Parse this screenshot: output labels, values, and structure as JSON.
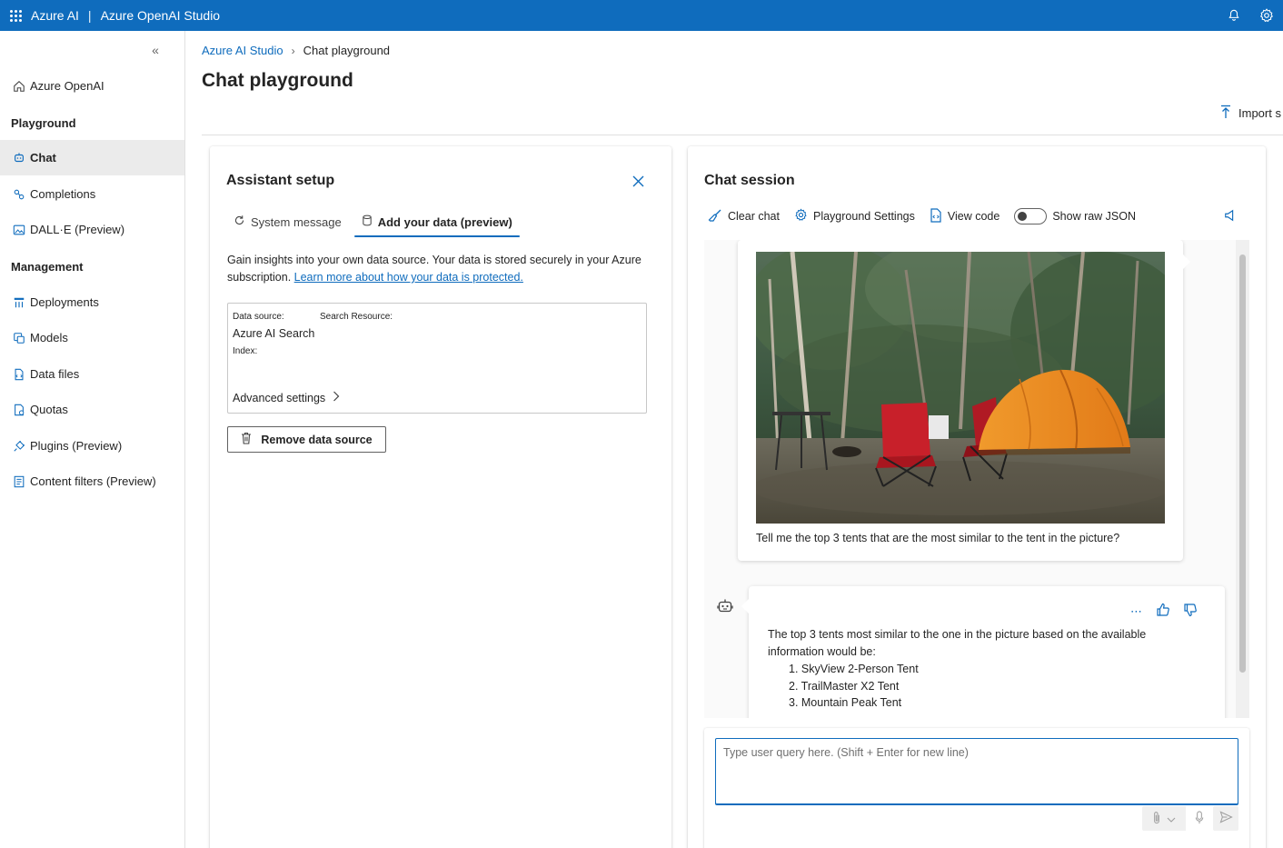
{
  "app": {
    "brand": "Azure AI",
    "separator": "|",
    "product": "Azure OpenAI Studio"
  },
  "topbar_icons": [
    "app-launcher-icon",
    "bell-icon",
    "gear-icon"
  ],
  "sidebar": {
    "home": "Azure OpenAI",
    "playground_heading": "Playground",
    "playground_items": [
      {
        "label": "Chat",
        "icon": "chat-icon",
        "active": true
      },
      {
        "label": "Completions",
        "icon": "completions-icon"
      },
      {
        "label": "DALL·E (Preview)",
        "icon": "image-icon"
      }
    ],
    "management_heading": "Management",
    "management_items": [
      {
        "label": "Deployments",
        "icon": "deployments-icon"
      },
      {
        "label": "Models",
        "icon": "models-icon"
      },
      {
        "label": "Data files",
        "icon": "data-files-icon"
      },
      {
        "label": "Quotas",
        "icon": "quotas-icon"
      },
      {
        "label": "Plugins (Preview)",
        "icon": "plugin-icon"
      },
      {
        "label": "Content filters (Preview)",
        "icon": "content-filter-icon"
      }
    ]
  },
  "breadcrumb": {
    "root": "Azure AI Studio",
    "current": "Chat playground"
  },
  "page": {
    "title": "Chat playground",
    "import_label": "Import s"
  },
  "setup": {
    "title": "Assistant setup",
    "tabs": {
      "system": "System message",
      "data": "Add your data (preview)"
    },
    "intro": "Gain insights into your own data source. Your data is stored securely in your Azure subscription. ",
    "intro_link": "Learn more about how your data is protected.",
    "data_source_label": "Data source:",
    "data_source_value": "Azure AI Search",
    "search_resource_label": "Search Resource:",
    "index_label": "Index:",
    "advanced_label": "Advanced settings",
    "remove_label": "Remove data source"
  },
  "chat": {
    "title": "Chat session",
    "toolbar": {
      "clear": "Clear chat",
      "settings": "Playground Settings",
      "view_code": "View code",
      "raw_json": "Show raw JSON"
    },
    "raw_json_on": false,
    "user_message": "Tell me the top 3 tents that are the most similar to the tent in the picture?",
    "bot_intro": "The top 3 tents most similar to the one in the picture based on the available information would be:",
    "bot_list": [
      "1. SkyView 2-Person Tent",
      "2. TrailMaster X2 Tent",
      "3. Mountain Peak Tent"
    ],
    "input_placeholder": "Type user query here. (Shift + Enter for new line)"
  },
  "colors": {
    "accent": "#0f6cbd",
    "tent": "#e8821e",
    "chair": "#c8202a"
  }
}
